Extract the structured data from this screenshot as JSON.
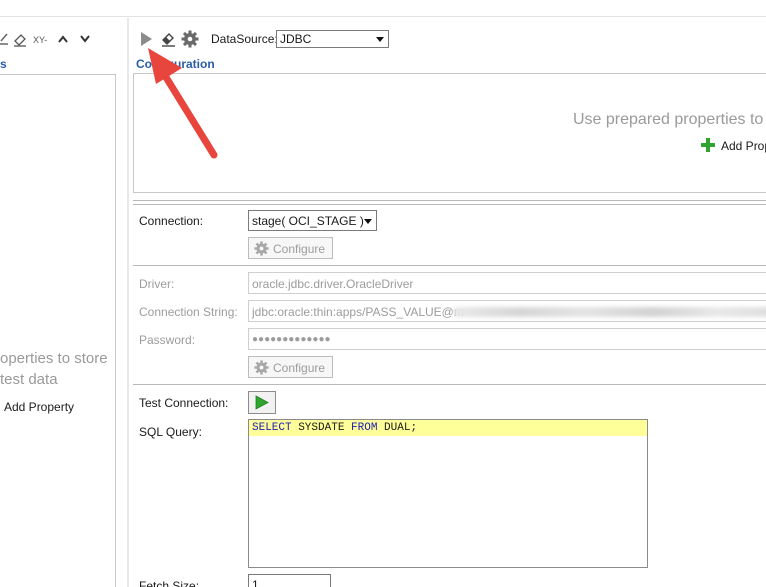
{
  "left_panel": {
    "toolbar_icons": [
      "pencil-icon",
      "eraser-icon",
      "sort-xy-icon",
      "move-up-icon",
      "move-down-icon"
    ],
    "toolbar_sort_label": "XY-",
    "heading": "s",
    "hint_line1": "operties to store",
    "hint_line2": "test data",
    "add_property_label": "Add Property"
  },
  "toolbar": {
    "icons": [
      "run-icon",
      "eraser-icon",
      "gear-icon"
    ],
    "datasource_label": "DataSource:",
    "datasource_value": "JDBC"
  },
  "configuration": {
    "heading": "Configuration",
    "hint": "Use prepared properties to",
    "add_property_label": "Add Prop"
  },
  "form": {
    "connection_label": "Connection:",
    "connection_value": "stage( OCI_STAGE )",
    "configure_label": "Configure",
    "driver_label": "Driver:",
    "driver_value": "oracle.jdbc.driver.OracleDriver",
    "connection_string_label": "Connection String:",
    "connection_string_value": "jdbc:oracle:thin:apps/PASS_VALUE@m",
    "password_label": "Password:",
    "password_value": "●●●●●●●●●●●●●",
    "configure2_label": "Configure",
    "test_connection_label": "Test Connection:",
    "sql_query_label": "SQL Query:",
    "sql_query": {
      "kw1": "SELECT",
      "t1": " SYSDATE ",
      "kw2": "FROM",
      "t2": " DUAL;"
    },
    "fetch_size_label": "Fetch Size:",
    "fetch_size_value": "1"
  },
  "colors": {
    "heading_blue": "#2a5ea8",
    "sql_highlight": "#ffff99",
    "sql_keyword": "#1b1bb6",
    "run_green": "#2fa52f",
    "annotation_arrow": "#e8453c"
  }
}
